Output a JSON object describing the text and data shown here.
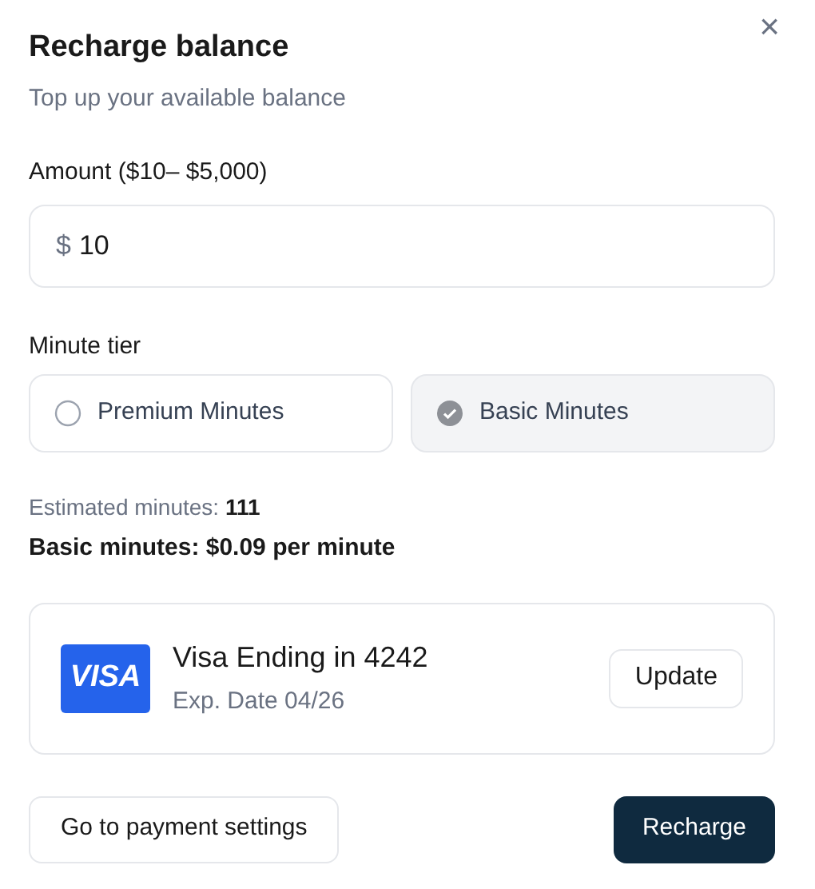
{
  "dialog": {
    "title": "Recharge balance",
    "subtitle": "Top up your available balance",
    "close": "×"
  },
  "amount": {
    "label": "Amount ($10– $5,000)",
    "prefix": "$",
    "value": "10"
  },
  "tier": {
    "label": "Minute tier",
    "options": [
      {
        "label": "Premium Minutes",
        "selected": false
      },
      {
        "label": "Basic Minutes",
        "selected": true
      }
    ]
  },
  "estimate": "Estimated minutes: **111**",
  "rate": "Basic minutes: $0.09 per minute",
  "card": {
    "brand": "VISA",
    "title": "Visa Ending in 4242",
    "expiry": "Exp. Date 04/26",
    "button": "Update"
  },
  "buttons": {
    "secondary": "Go to payment settings",
    "primary": "Recharge"
  }
}
